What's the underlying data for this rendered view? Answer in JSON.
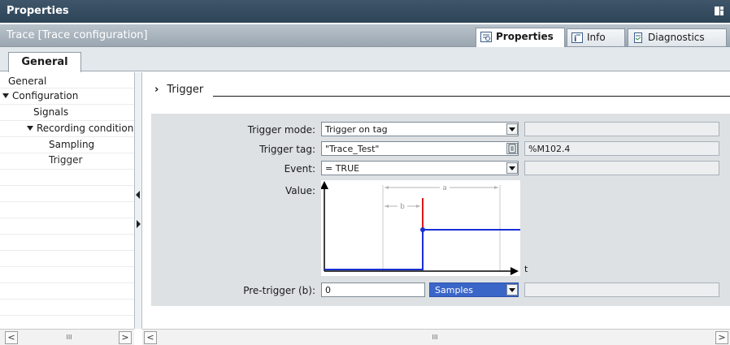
{
  "window": {
    "title": "Properties"
  },
  "object_bar": {
    "title": "Trace [Trace configuration]",
    "tabs": [
      {
        "label": "Properties",
        "icon": "properties-icon",
        "active": true
      },
      {
        "label": "Info",
        "icon": "info-icon",
        "active": false
      },
      {
        "label": "Diagnostics",
        "icon": "diagnostics-icon",
        "active": false
      }
    ]
  },
  "tab_strip": {
    "general": "General"
  },
  "nav": {
    "items": [
      {
        "label": "General",
        "level": 0,
        "expanded": null
      },
      {
        "label": "Configuration",
        "level": 0,
        "expanded": true
      },
      {
        "label": "Signals",
        "level": 1,
        "expanded": null
      },
      {
        "label": "Recording conditions",
        "level": 1,
        "expanded": true
      },
      {
        "label": "Sampling",
        "level": 2,
        "expanded": null
      },
      {
        "label": "Trigger",
        "level": 2,
        "expanded": null,
        "selected": true
      }
    ]
  },
  "section": {
    "chevron": "›",
    "title": "Trigger"
  },
  "form": {
    "trigger_mode": {
      "label": "Trigger mode:",
      "value": "Trigger on tag"
    },
    "trigger_tag": {
      "label": "Trigger tag:",
      "value": "\"Trace_Test\"",
      "address": "%M102.4"
    },
    "event": {
      "label": "Event:",
      "value": "= TRUE"
    },
    "value": {
      "label": "Value:"
    },
    "pretrigger": {
      "label": "Pre-trigger (b):",
      "value": "0",
      "unit": "Samples"
    }
  },
  "chart_labels": {
    "a": "a",
    "b": "b",
    "t": "t"
  },
  "scrollbars": {
    "grip": "III"
  },
  "colors": {
    "accent": "#3a66c8",
    "signal": "#1a2fd6",
    "trigger": "#e01818"
  }
}
